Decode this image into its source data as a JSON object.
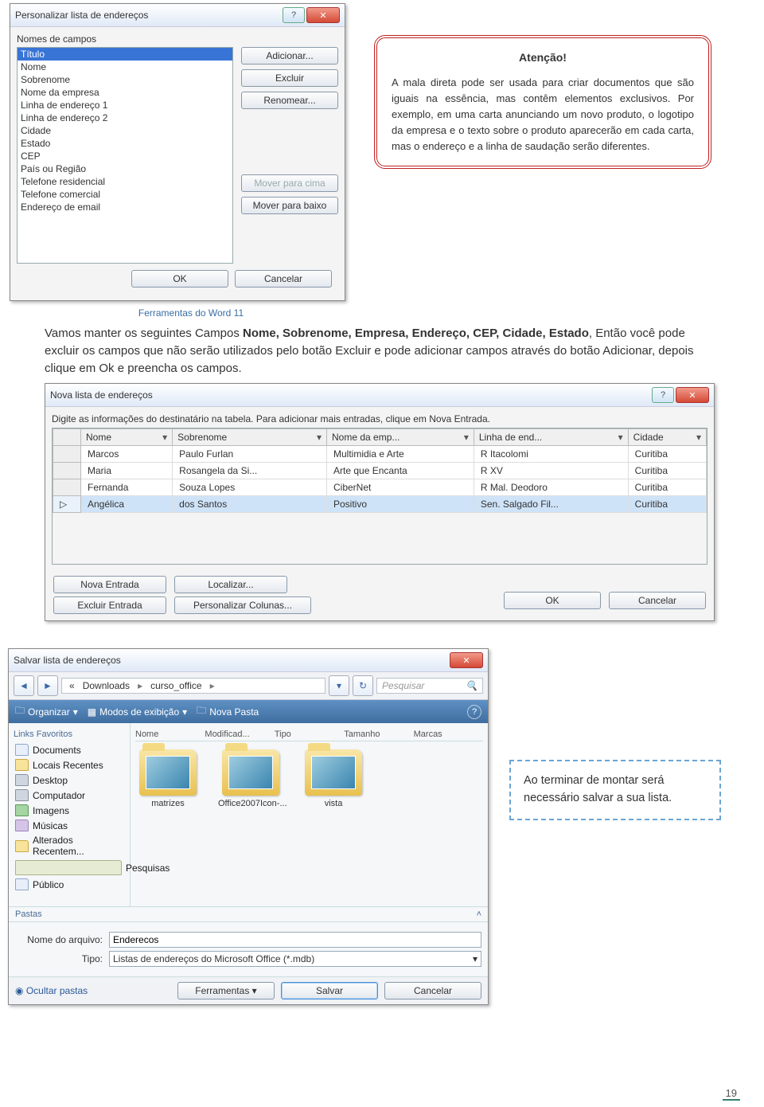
{
  "dlg1": {
    "title": "Personalizar lista de endereços",
    "fieldNamesLabel": "Nomes de campos",
    "fields": [
      "Título",
      "Nome",
      "Sobrenome",
      "Nome da empresa",
      "Linha de endereço 1",
      "Linha de endereço 2",
      "Cidade",
      "Estado",
      "CEP",
      "País ou Região",
      "Telefone residencial",
      "Telefone comercial",
      "Endereço de email"
    ],
    "btnAdd": "Adicionar...",
    "btnDel": "Excluir",
    "btnRen": "Renomear...",
    "btnUp": "Mover para cima",
    "btnDown": "Mover para baixo",
    "ok": "OK",
    "cancel": "Cancelar"
  },
  "attn": {
    "title": "Atenção!",
    "p1": "A mala direta pode ser usada para criar documentos que são iguais na essência, mas contêm elementos exclusivos. Por exemplo, em uma carta anunciando um novo produto, o logotipo da empresa e o texto sobre o produto aparecerão em cada carta, mas o endereço e a linha de saudação serão diferentes."
  },
  "caption1": "Ferramentas do Word 11",
  "para1a": "Vamos manter os seguintes Campos ",
  "para1b": "Nome, Sobrenome, Empresa, Endereço, CEP, Cidade, Estado",
  "para1c": ", Então você pode excluir os campos que não serão utilizados pelo botão Excluir e pode adicionar campos através do botão Adicionar, depois clique em Ok e preencha os campos.",
  "dlg2": {
    "title": "Nova lista de endereços",
    "ins": "Digite as informações do destinatário na tabela. Para adicionar mais entradas, clique em Nova Entrada.",
    "cols": [
      "Nome",
      "Sobrenome",
      "Nome da emp...",
      "Linha de end...",
      "Cidade"
    ],
    "rows": [
      [
        "Marcos",
        "Paulo Furlan",
        "Multimidia e Arte",
        "R Itacolomi",
        "Curitiba"
      ],
      [
        "Maria",
        "Rosangela da Si...",
        "Arte que Encanta",
        "R XV",
        "Curitiba"
      ],
      [
        "Fernanda",
        "Souza Lopes",
        "CiberNet",
        "R Mal. Deodoro",
        "Curitiba"
      ],
      [
        "Angélica",
        "dos Santos",
        "Positivo",
        "Sen. Salgado Fil...",
        "Curitiba"
      ]
    ],
    "btnNew": "Nova Entrada",
    "btnFind": "Localizar...",
    "btnDel": "Excluir Entrada",
    "btnCust": "Personalizar Colunas...",
    "ok": "OK",
    "cancel": "Cancelar"
  },
  "dlg3": {
    "title": "Salvar lista de endereços",
    "crumb": [
      "Downloads",
      "curso_office"
    ],
    "search": "Pesquisar",
    "org": "Organizar",
    "views": "Modos de exibição",
    "newf": "Nova Pasta",
    "colhdrs": [
      "Nome",
      "Modificad...",
      "Tipo",
      "Tamanho",
      "Marcas"
    ],
    "favHdr": "Links Favoritos",
    "favs": [
      "Documents",
      "Locais Recentes",
      "Desktop",
      "Computador",
      "Imagens",
      "Músicas",
      "Alterados Recentem...",
      "Pesquisas",
      "Público"
    ],
    "pastas": "Pastas",
    "folders": [
      "matrizes",
      "Office2007Icon-...",
      "vista"
    ],
    "fnLabel": "Nome do arquivo:",
    "fnVal": "Enderecos",
    "tpLabel": "Tipo:",
    "tpVal": "Listas de endereços do Microsoft Office (*.mdb)",
    "hide": "Ocultar pastas",
    "tools": "Ferramentas",
    "save": "Salvar",
    "cancel": "Cancelar"
  },
  "tip": "Ao terminar de montar será necessário salvar a sua lista.",
  "pagenum": "19"
}
